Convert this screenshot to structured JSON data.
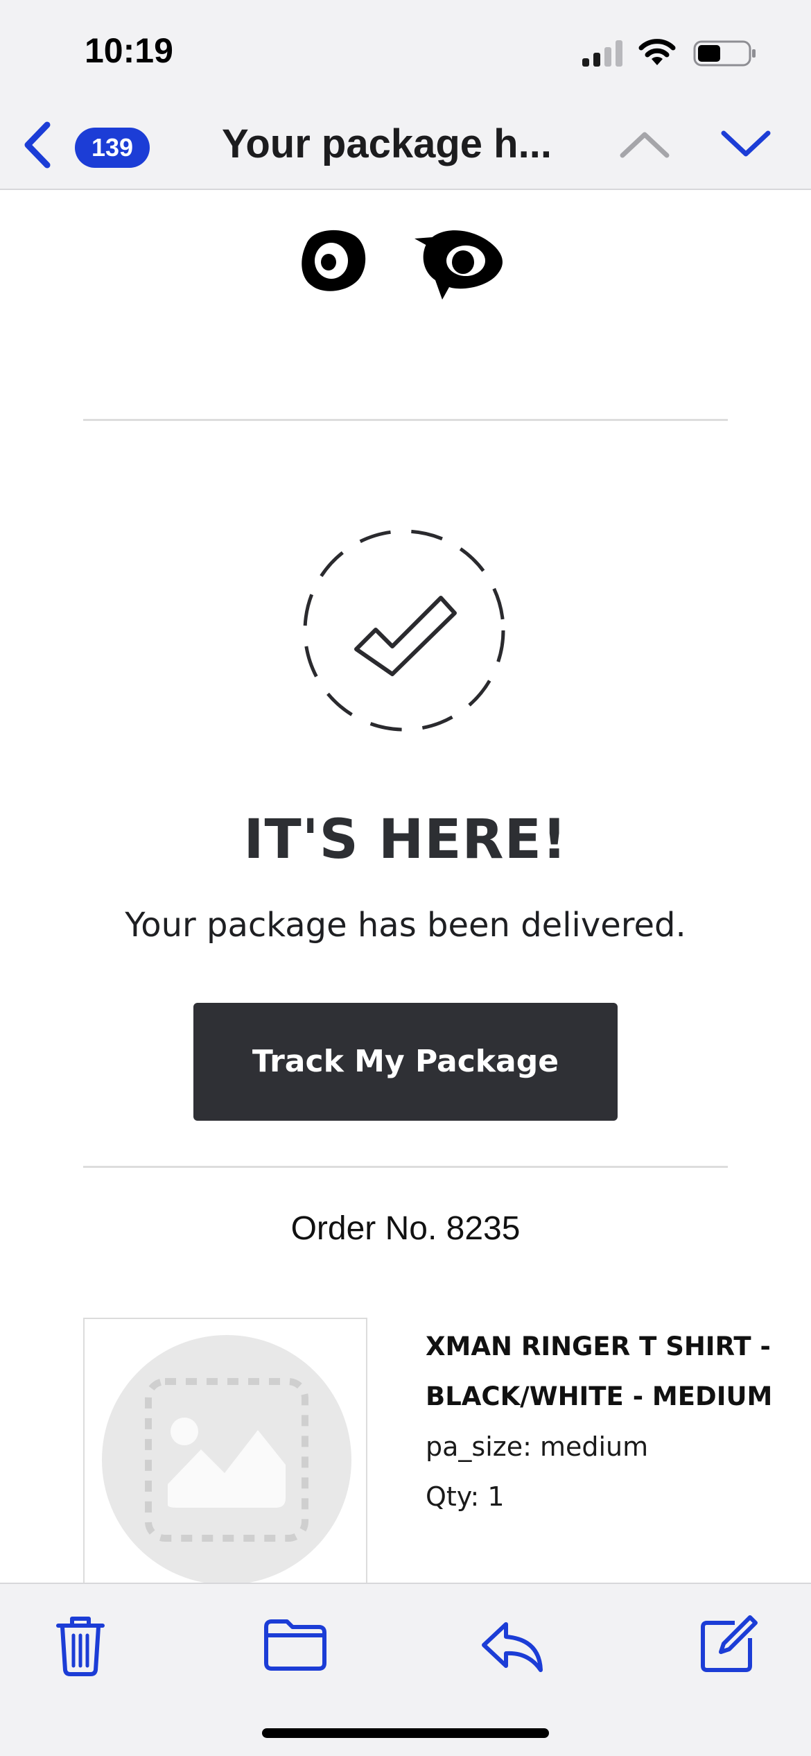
{
  "status_bar": {
    "time": "10:19"
  },
  "nav": {
    "unread_count": "139",
    "title": "Your package h...",
    "accent_color": "#1c3dd6"
  },
  "email": {
    "headline": "IT'S HERE!",
    "message": "Your package has been delivered.",
    "track_button_label": "Track My Package",
    "order_number": "Order No. 8235",
    "product": {
      "name_line1": "XMAN RINGER T SHIRT -",
      "name_line2": "BLACK/WHITE - MEDIUM",
      "size": "pa_size: medium",
      "quantity": "Qty: 1"
    }
  },
  "toolbar": {
    "icons": [
      "trash-icon",
      "folder-icon",
      "reply-icon",
      "compose-icon"
    ]
  }
}
